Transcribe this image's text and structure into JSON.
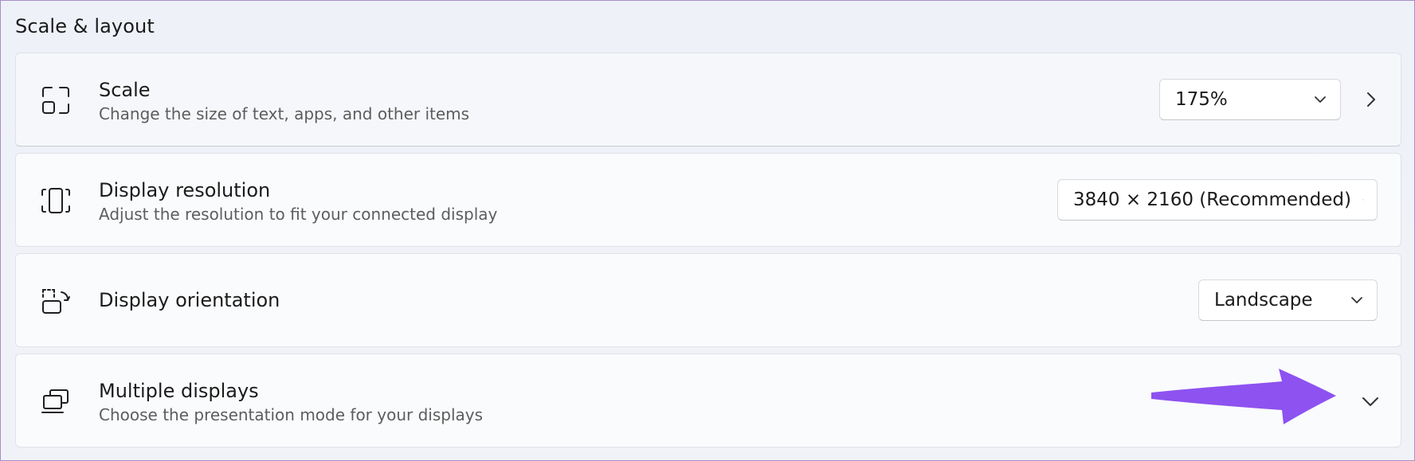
{
  "section": {
    "title": "Scale & layout"
  },
  "settings": [
    {
      "title": "Scale",
      "subtitle": "Change the size of text, apps, and other items",
      "icon": "scale-icon",
      "dropdown_value": "175%"
    },
    {
      "title": "Display resolution",
      "subtitle": "Adjust the resolution to fit your connected display",
      "icon": "resolution-icon",
      "dropdown_value": "3840 × 2160 (Recommended)"
    },
    {
      "title": "Display orientation",
      "icon": "orientation-icon",
      "dropdown_value": "Landscape"
    },
    {
      "title": "Multiple displays",
      "subtitle": "Choose the presentation mode for your displays",
      "icon": "multiple-displays-icon"
    }
  ],
  "colors": {
    "annotation_arrow": "#8d52f0",
    "card_background": "#fafbfd",
    "page_background": "#eef1f7"
  }
}
